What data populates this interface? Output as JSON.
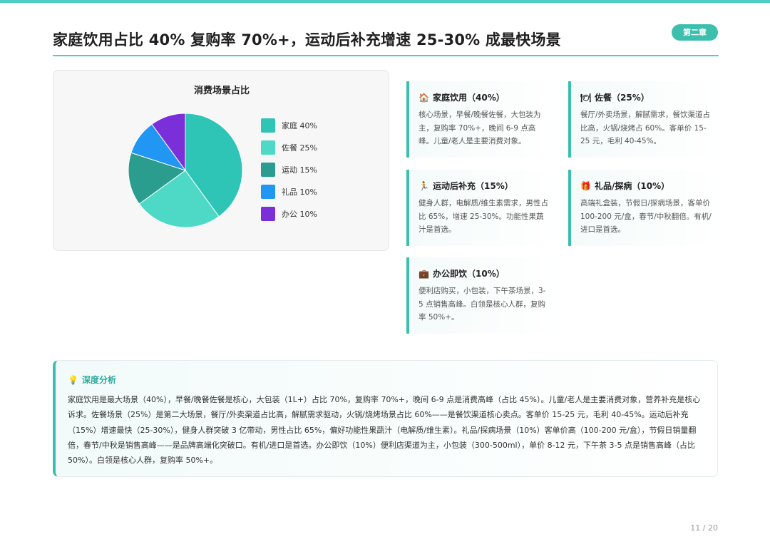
{
  "title": "家庭饮用占比 40% 复购率 70%+，运动后补充增速 25-30% 成最快场景",
  "chapter": "第二章",
  "page_number": "11 / 20",
  "colors": {
    "accent": "#3dbfae",
    "rule": "#4ecdc4"
  },
  "chart_data": {
    "type": "pie",
    "title": "消费场景占比",
    "legend_position": "right",
    "slices": [
      {
        "label": "家庭 40%",
        "value": 40,
        "color": "#2ec4b6"
      },
      {
        "label": "佐餐 25%",
        "value": 25,
        "color": "#4dd9c5"
      },
      {
        "label": "运动 15%",
        "value": 15,
        "color": "#2a9d8f"
      },
      {
        "label": "礼品 10%",
        "value": 10,
        "color": "#2196f3"
      },
      {
        "label": "办公 10%",
        "value": 10,
        "color": "#7b2fd9"
      }
    ]
  },
  "cards": [
    {
      "icon": "house-icon",
      "glyph": "🏠",
      "title": "家庭饮用（40%）",
      "body": "核心场景，早餐/晚餐佐餐，大包装为主，复购率 70%+，晚间 6-9 点高峰。儿童/老人是主要消费对象。"
    },
    {
      "icon": "tableware-icon",
      "glyph": "🍽",
      "title": "佐餐（25%）",
      "body": "餐厅/外卖场景，解腻需求，餐饮渠道占比高，火锅/烧烤占 60%。客单价 15-25 元，毛利 40-45%。"
    },
    {
      "icon": "runner-icon",
      "glyph": "🏃",
      "title": "运动后补充（15%）",
      "body": "健身人群，电解质/维生素需求，男性占比 65%，增速 25-30%。功能性果蔬汁是首选。"
    },
    {
      "icon": "gift-icon",
      "glyph": "🎁",
      "title": "礼品/探病（10%）",
      "body": "高端礼盒装，节假日/探病场景，客单价 100-200 元/盒，春节/中秋翻倍。有机/进口是首选。"
    },
    {
      "icon": "briefcase-icon",
      "glyph": "💼",
      "title": "办公即饮（10%）",
      "body": "便利店购买，小包装，下午茶场景，3-5 点销售高峰。白领是核心人群，复购率 50%+。"
    }
  ],
  "analysis": {
    "icon": "lightbulb-icon",
    "glyph": "💡",
    "title": "深度分析",
    "body": "家庭饮用是最大场景（40%），早餐/晚餐佐餐是核心，大包装（1L+）占比 70%，复购率 70%+，晚间 6-9 点是消费高峰（占比 45%）。儿童/老人是主要消费对象，营养补充是核心诉求。佐餐场景（25%）是第二大场景，餐厅/外卖渠道占比高，解腻需求驱动，火锅/烧烤场景占比 60%——是餐饮渠道核心卖点。客单价 15-25 元，毛利 40-45%。运动后补充（15%）增速最快（25-30%），健身人群突破 3 亿带动，男性占比 65%，偏好功能性果蔬汁（电解质/维生素）。礼品/探病场景（10%）客单价高（100-200 元/盒），节假日销量翻倍，春节/中秋是销售高峰——是品牌高端化突破口。有机/进口是首选。办公即饮（10%）便利店渠道为主，小包装（300-500ml），单价 8-12 元，下午茶 3-5 点是销售高峰（占比 50%）。白领是核心人群，复购率 50%+。"
  }
}
